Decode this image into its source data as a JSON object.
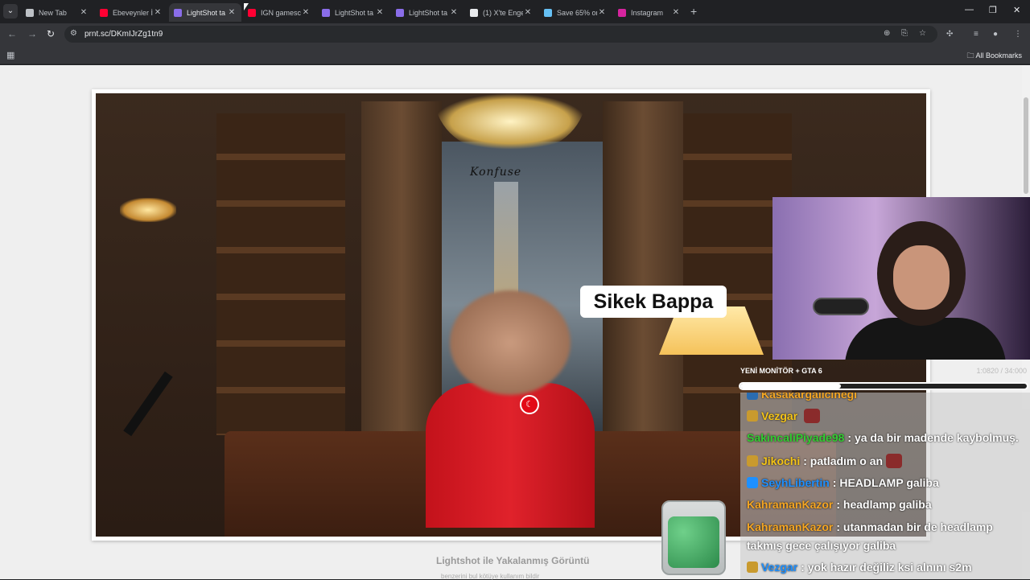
{
  "browser": {
    "tabs": [
      {
        "title": "New Tab",
        "favicon_color": "#bdc1c6"
      },
      {
        "title": "Ebeveynler İ",
        "favicon_color": "#ff0033"
      },
      {
        "title": "LightShot ta",
        "favicon_color": "#8a6de9",
        "active": true
      },
      {
        "title": "IGN gamesc",
        "favicon_color": "#ff0033"
      },
      {
        "title": "LightShot ta",
        "favicon_color": "#8a6de9"
      },
      {
        "title": "LightShot ta",
        "favicon_color": "#8a6de9"
      },
      {
        "title": "(1) X'te Enge",
        "favicon_color": "#e8eaed"
      },
      {
        "title": "Save 65% on",
        "favicon_color": "#66c0f4"
      },
      {
        "title": "Instagram",
        "favicon_color": "#d6249f"
      }
    ],
    "new_tab_icon": "+",
    "url": "prnt.sc/DKmIJrZg1tn9",
    "bookmarks_label": "All Bookmarks"
  },
  "screenshot": {
    "overlay_label": "Sikek Bappa",
    "brand_text": "Konfuse"
  },
  "stream": {
    "title": "YENİ MONİTÖR + GTA 6",
    "meta": "1:0820 / 34:000",
    "progress_fraction": 0.35,
    "chat": [
      {
        "user": "Kasakargalicihegi",
        "text": "",
        "color": "#f5a623",
        "badge_color": "#2b6cb0"
      },
      {
        "user": "Vezgar",
        "text": "",
        "color": "#f5c518",
        "badge_color": "#c99a2e",
        "emote": true
      },
      {
        "user": "SakincaliPiyade98",
        "text": ": ya da bir madende kaybolmuş.",
        "color": "#32cd32",
        "badge_color": ""
      },
      {
        "user": "Jikochi",
        "text": ": patladım o an",
        "color": "#f5c518",
        "badge_color": "#c99a2e",
        "emote": true
      },
      {
        "user": "SeyhLibertin",
        "text": ": HEADLAMP galiba",
        "color": "#1e90ff",
        "badge_color": "#1e90ff"
      },
      {
        "user": "KahramanKazor",
        "text": ": headlamp galiba",
        "color": "#f5a623",
        "badge_color": ""
      },
      {
        "user": "KahramanKazor",
        "text": ": utanmadan bir de headlamp",
        "color": "#f5a623",
        "badge_color": ""
      },
      {
        "user": "",
        "text": "takmış gece çalışıyor galiba",
        "color": "#ffffff",
        "badge_color": ""
      },
      {
        "user": "Vezgar",
        "text": ": yok hazır değiliz ksi alnını s2m",
        "color": "#1e90ff",
        "badge_color": "#c99a2e"
      }
    ]
  },
  "page": {
    "caption": "Lightshot ile Yakalanmış Görüntü",
    "links": "benzerini bul    kötüye kullanım bildir"
  }
}
